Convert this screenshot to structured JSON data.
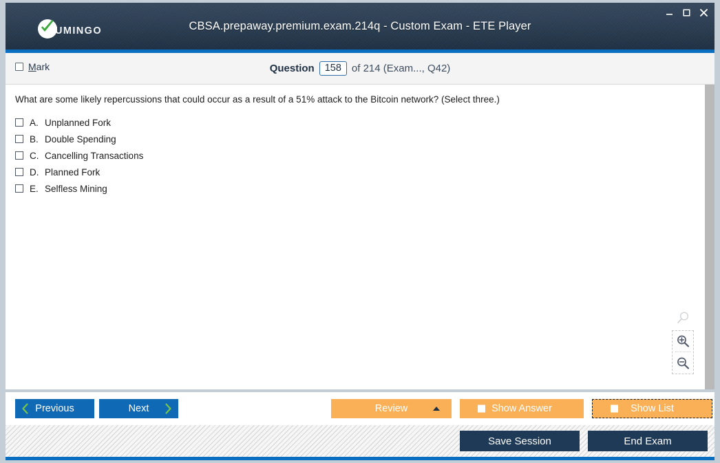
{
  "window": {
    "title": "CBSA.prepaway.premium.exam.214q - Custom Exam - ETE Player",
    "logo_text": "UMINGO",
    "controls": {
      "minimize": "minimize",
      "maximize": "maximize",
      "close": "close"
    },
    "accent_color": "#0a6fc0",
    "titlebar_color": "#2f4156"
  },
  "question_bar": {
    "mark_label_accel": "M",
    "mark_label_rest": "ark",
    "mark_checked": false,
    "question_label": "Question",
    "question_number": "158",
    "of_text": "of 214 (Exam..., Q42)"
  },
  "content": {
    "question_text": "What are some likely repercussions that could occur as a result of a 51% attack to the Bitcoin network? (Select three.)",
    "options": [
      {
        "letter": "A.",
        "text": "Unplanned Fork",
        "checked": false
      },
      {
        "letter": "B.",
        "text": "Double Spending",
        "checked": false
      },
      {
        "letter": "C.",
        "text": "Cancelling Transactions",
        "checked": false
      },
      {
        "letter": "D.",
        "text": "Planned Fork",
        "checked": false
      },
      {
        "letter": "E.",
        "text": "Selfless Mining",
        "checked": false
      }
    ],
    "zoom_tools": {
      "reset": "zoom-reset-icon",
      "zoom_in": "zoom-in-icon",
      "zoom_out": "zoom-out-icon"
    }
  },
  "navbar": {
    "previous_label": "Previous",
    "next_label": "Next",
    "review_label": "Review",
    "show_answer_label": "Show Answer",
    "show_list_label": "Show List",
    "show_answer_checked": false,
    "show_list_checked": false,
    "blue_color": "#0f69b4",
    "orange_color": "#f9b057"
  },
  "footer": {
    "save_session_label": "Save Session",
    "end_exam_label": "End Exam",
    "dark_color": "#1f3a56"
  }
}
